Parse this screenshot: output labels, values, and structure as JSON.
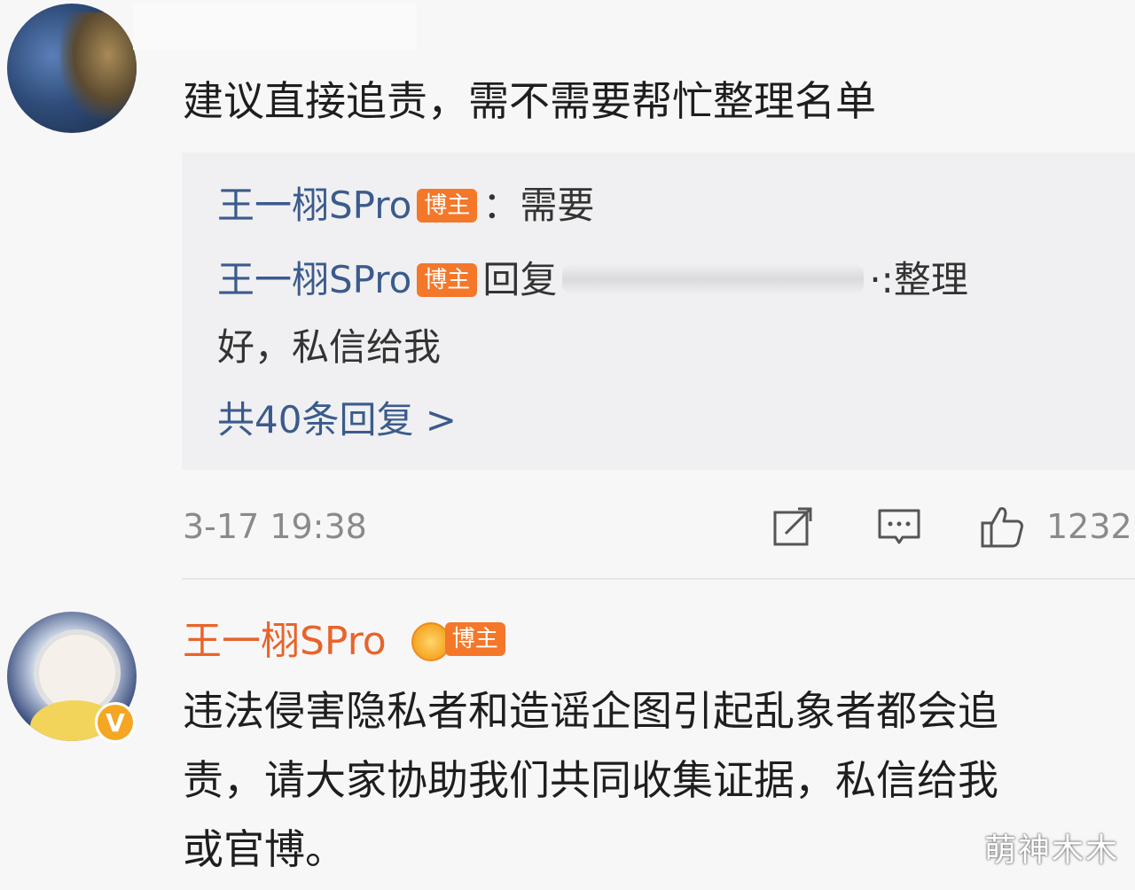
{
  "comment1": {
    "text": "建议直接追责，需不需要帮忙整理名单"
  },
  "replies": {
    "reply1": {
      "user": "王一栩SPro",
      "badge": "博主",
      "text": "：需要"
    },
    "reply2": {
      "user": "王一栩SPro",
      "badge": "博主",
      "prefix": "回复",
      "text_end": "·:整理",
      "text_cont": "好，私信给我"
    },
    "more_link": "共40条回复 >"
  },
  "meta": {
    "timestamp": "3-17 19:38",
    "like_count": "1232"
  },
  "comment2": {
    "user": "王一栩SPro",
    "badge": "博主",
    "line1": "违法侵害隐私者和造谣企图引起乱象者都会追",
    "line2": "责，请大家协助我们共同收集证据，私信给我",
    "line3": "或官博。"
  },
  "verified_mark": "V",
  "watermark": "萌神木木",
  "colors": {
    "username_blue": "#3b5b8c",
    "author_orange": "#e8642a",
    "badge_orange": "#f4772a"
  }
}
